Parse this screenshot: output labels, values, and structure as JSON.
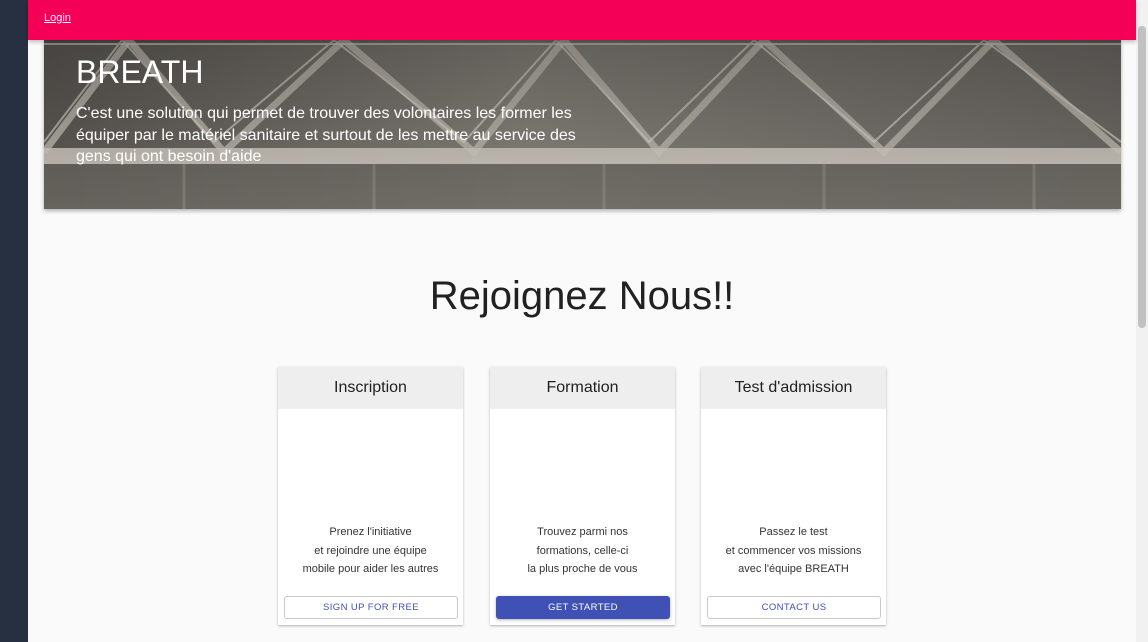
{
  "appbar": {
    "login_link": "Login",
    "color": "#f50057"
  },
  "hero": {
    "title": "BREATH",
    "description_lines": [
      "C'est une solution qui permet de trouver des volontaires les former les",
      "équiper par le matériel sanitaire et surtout de les mettre au service des",
      "gens qui ont besoin d'aide"
    ]
  },
  "section": {
    "title": "Rejoignez Nous!!"
  },
  "cards": [
    {
      "header": "Inscription",
      "lines": [
        "Prenez l'initiative",
        "et rejoindre une équipe",
        "mobile pour aider les autres"
      ],
      "button": "Sign up for free",
      "button_style": "outlined"
    },
    {
      "header": "Formation",
      "lines": [
        "Trouvez parmi nos",
        "formations, celle-ci",
        "la plus proche de vous"
      ],
      "button": "Get started",
      "button_style": "contained"
    },
    {
      "header": "Test d'admission",
      "lines": [
        "Passez le test",
        "et commencer vos missions",
        "avec l'équipe BREATH"
      ],
      "button": "Contact us",
      "button_style": "outlined"
    }
  ],
  "colors": {
    "primary": "#3f51b5",
    "secondary": "#f50057"
  }
}
